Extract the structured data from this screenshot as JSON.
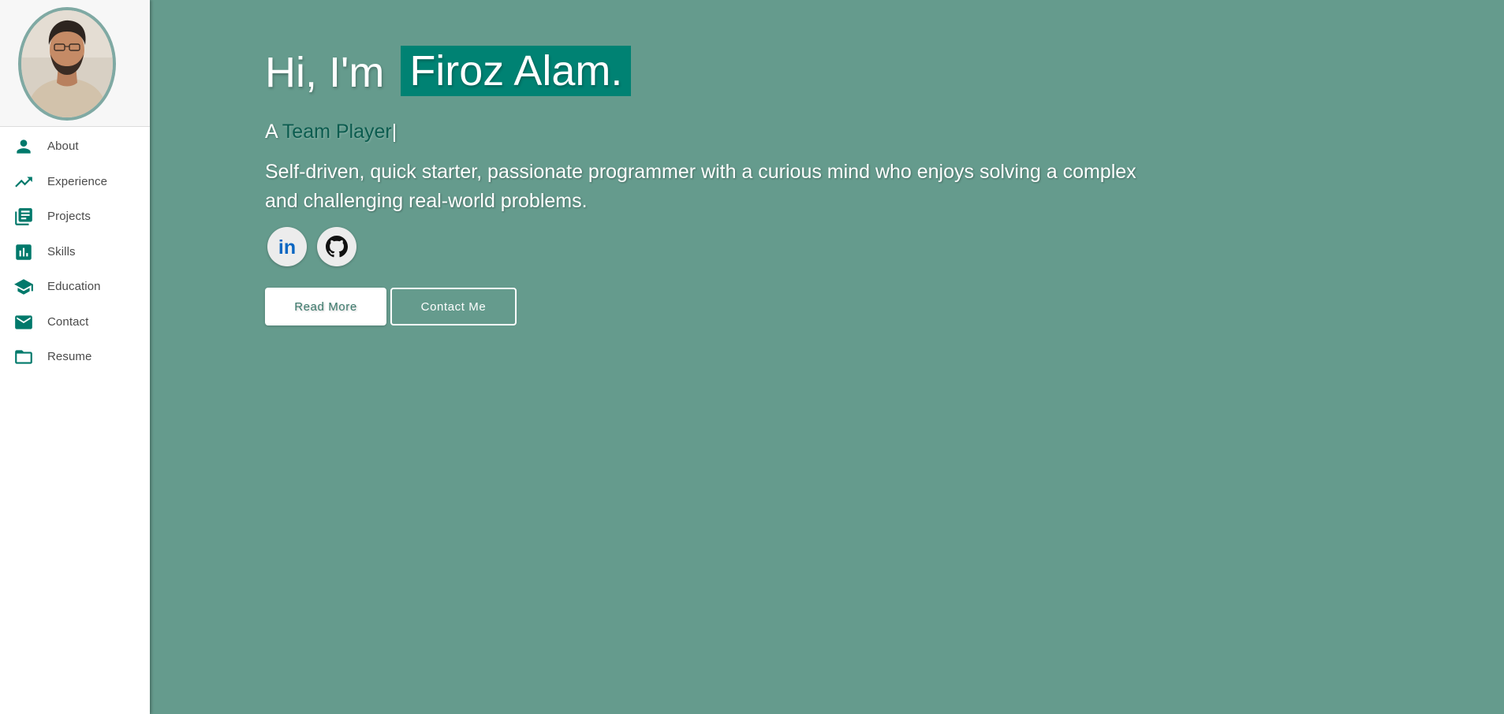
{
  "sidebar": {
    "avatar_alt": "Profile photo",
    "items": [
      {
        "label": "About",
        "icon": "person-icon"
      },
      {
        "label": "Experience",
        "icon": "trending-up-icon"
      },
      {
        "label": "Projects",
        "icon": "library-books-icon"
      },
      {
        "label": "Skills",
        "icon": "bar-chart-icon"
      },
      {
        "label": "Education",
        "icon": "school-icon"
      },
      {
        "label": "Contact",
        "icon": "mail-icon"
      },
      {
        "label": "Resume",
        "icon": "folder-icon"
      }
    ]
  },
  "hero": {
    "greeting": "Hi, I'm",
    "name": "Firoz Alam.",
    "typed_prefix": "A",
    "typed_word": "Team Player",
    "typed_cursor": "|",
    "tagline": "Self-driven, quick starter, passionate programmer with a curious mind who enjoys solving a complex and challenging real-world problems."
  },
  "social": {
    "linkedin_label": "in",
    "github_label": "GitHub"
  },
  "buttons": {
    "read_more": "Read More",
    "contact_me": "Contact Me"
  },
  "colors": {
    "background": "#659b8d",
    "accent": "#008273",
    "sidebar_icon": "#00796b",
    "typed_word": "#0c5c4f",
    "linkedin": "#0a66c2"
  }
}
